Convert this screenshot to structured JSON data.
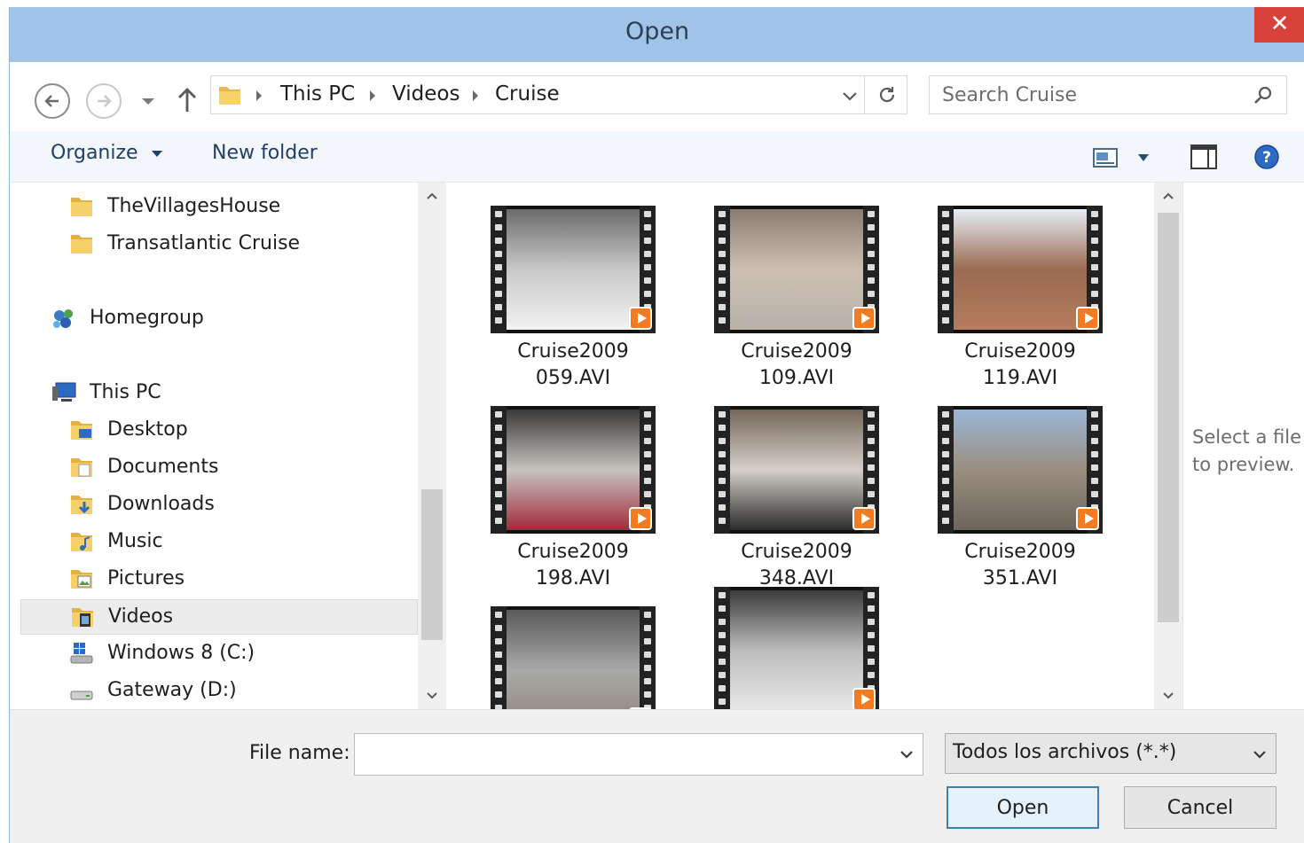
{
  "window": {
    "title": "Open",
    "close_glyph": "✕"
  },
  "address": {
    "crumbs": [
      "This PC",
      "Videos",
      "Cruise"
    ],
    "search_placeholder": "Search Cruise"
  },
  "toolbar": {
    "organize_label": "Organize",
    "new_folder_label": "New folder"
  },
  "nav": {
    "items": [
      {
        "label": "TheVillagesHouse",
        "icon": "folder-icon"
      },
      {
        "label": "Transatlantic Cruise",
        "icon": "folder-icon"
      },
      {
        "label": "Homegroup",
        "icon": "homegroup-icon"
      },
      {
        "label": "This PC",
        "icon": "computer-icon"
      },
      {
        "label": "Desktop",
        "icon": "desktop-folder-icon"
      },
      {
        "label": "Documents",
        "icon": "documents-folder-icon"
      },
      {
        "label": "Downloads",
        "icon": "downloads-folder-icon"
      },
      {
        "label": "Music",
        "icon": "music-folder-icon"
      },
      {
        "label": "Pictures",
        "icon": "pictures-folder-icon"
      },
      {
        "label": "Videos",
        "icon": "videos-folder-icon",
        "selected": true
      },
      {
        "label": "Windows 8 (C:)",
        "icon": "system-drive-icon"
      },
      {
        "label": "Gateway (D:)",
        "icon": "drive-icon"
      }
    ]
  },
  "files": [
    {
      "line1": "Cruise2009",
      "line2": "059.AVI",
      "colors": [
        "#6b6b6b",
        "#c9c9c9",
        "#f2f2f2"
      ]
    },
    {
      "line1": "Cruise2009",
      "line2": "109.AVI",
      "colors": [
        "#8a7b70",
        "#cdbfb2",
        "#b8b2a9"
      ]
    },
    {
      "line1": "Cruise2009",
      "line2": "119.AVI",
      "colors": [
        "#e6eef5",
        "#9a6a52",
        "#b57c5c"
      ]
    },
    {
      "line1": "Cruise2009",
      "line2": "198.AVI",
      "colors": [
        "#3a3a3a",
        "#c7c3bf",
        "#a12b3b"
      ]
    },
    {
      "line1": "Cruise2009",
      "line2": "348.AVI",
      "colors": [
        "#75665a",
        "#d4cfc8",
        "#2b2b2b"
      ]
    },
    {
      "line1": "Cruise2009",
      "line2": "351.AVI",
      "colors": [
        "#9ab7d6",
        "#9a8e7e",
        "#6b655b"
      ]
    },
    {
      "line1": "",
      "line2": "",
      "colors": [
        "#5a5a5a",
        "#a9a9a9",
        "#8e8479"
      ]
    },
    {
      "line1": "",
      "line2": "",
      "colors": [
        "#3c3c3c",
        "#bdbdbd",
        "#e8e8e8"
      ]
    }
  ],
  "preview": {
    "message": "Select a file to preview."
  },
  "bottom": {
    "filename_label": "File name:",
    "filename_value": "",
    "filetype_label": "Todos los archivos (*.*)",
    "open_label": "Open",
    "cancel_label": "Cancel"
  }
}
